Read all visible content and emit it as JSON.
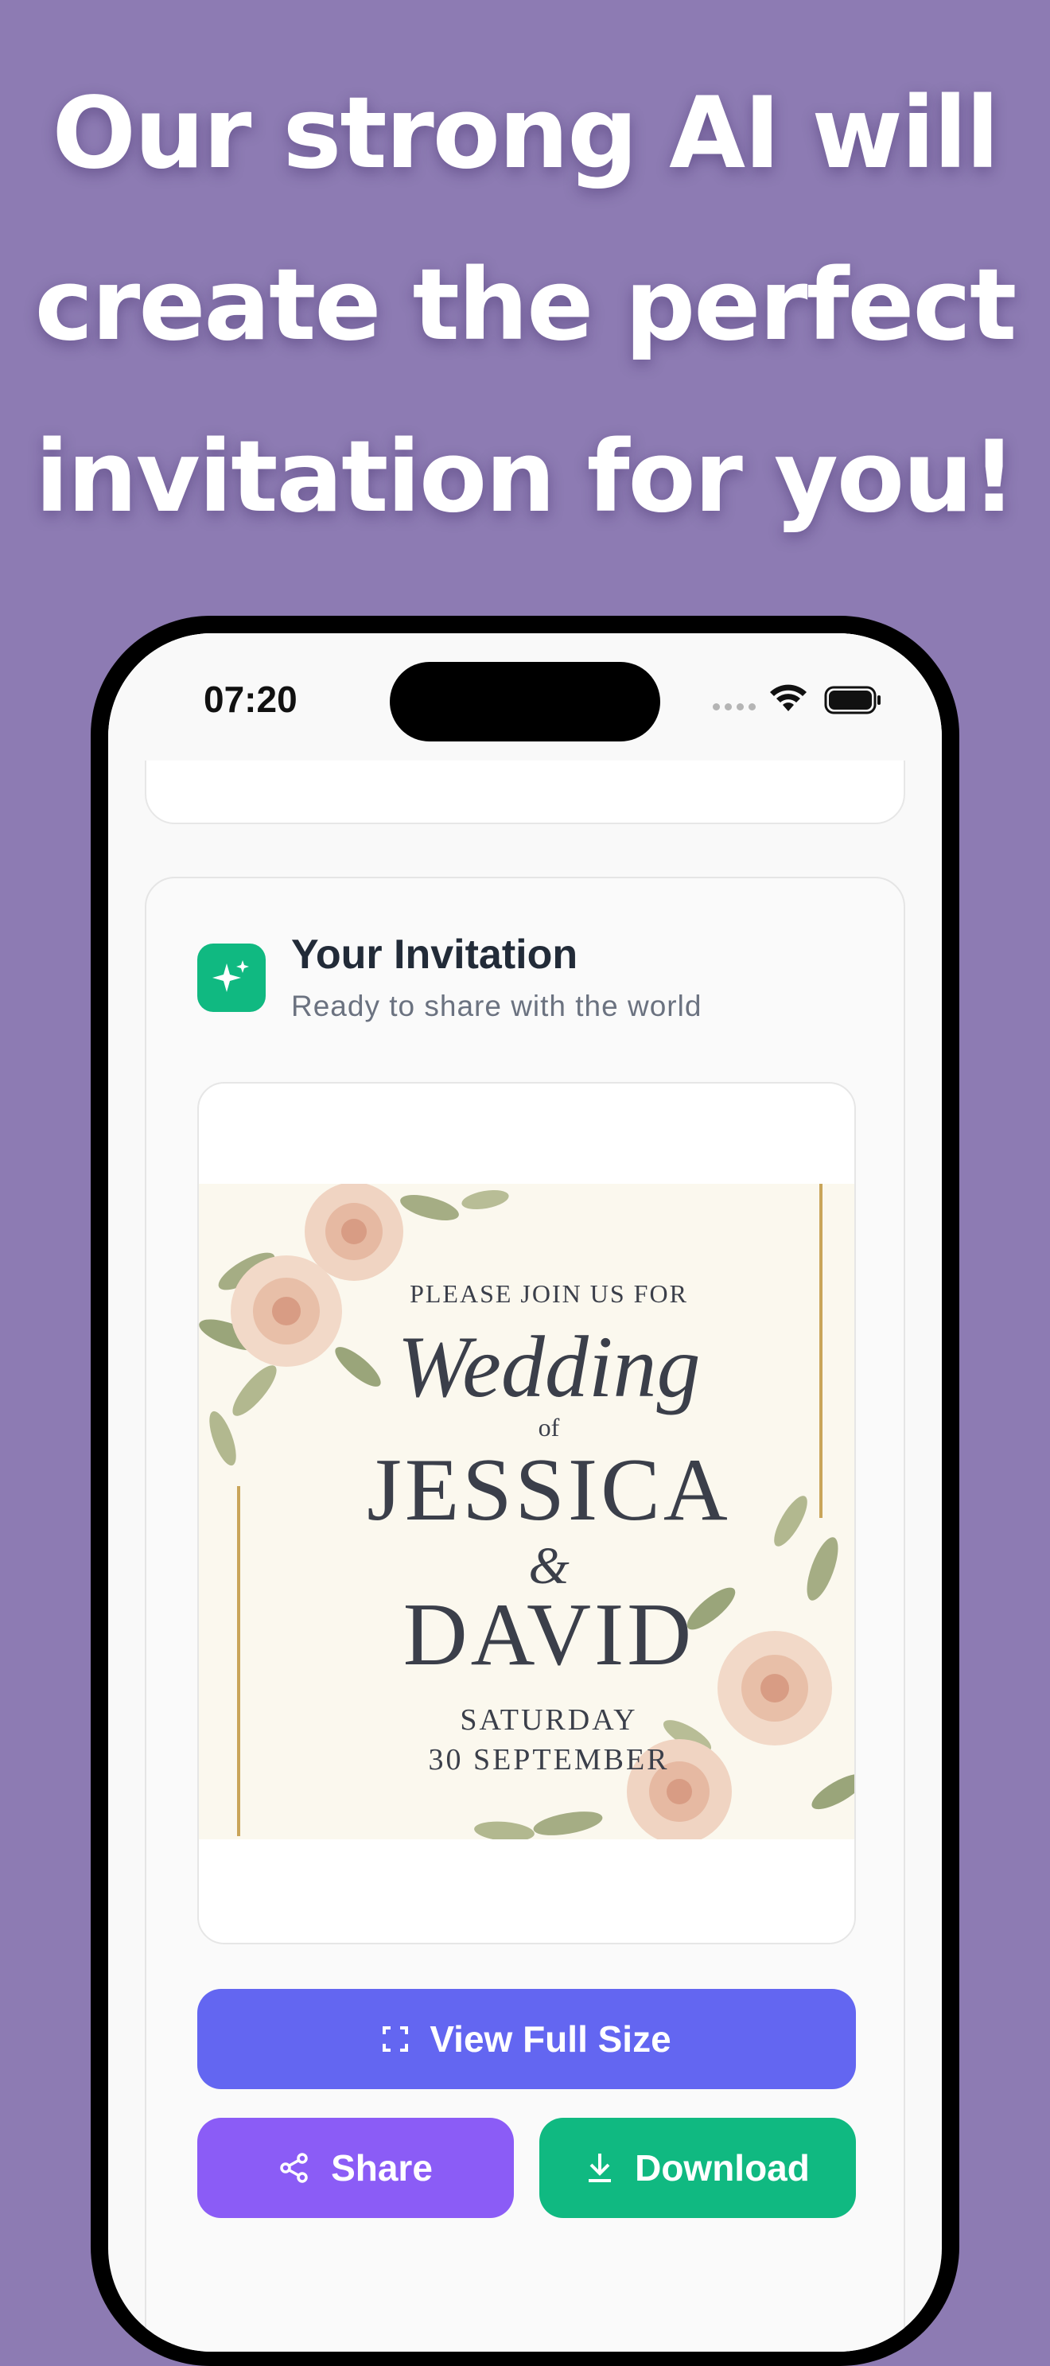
{
  "headline": {
    "line1": "Our strong AI will",
    "line2": "create the perfect",
    "line3": "invitation for you!"
  },
  "status_bar": {
    "time": "07:20"
  },
  "invitation_card": {
    "title": "Your Invitation",
    "subtitle": "Ready to share with the world",
    "icon": "sparkles-icon"
  },
  "invitation_image": {
    "join_text": "PLEASE JOIN US FOR",
    "script_text": "Wedding",
    "of_text": "of",
    "name1": "JESSICA",
    "ampersand": "&",
    "name2": "DAVID",
    "day": "SATURDAY",
    "date": "30 SEPTEMBER"
  },
  "actions": {
    "view_full_size": "View Full Size",
    "share": "Share",
    "download": "Download"
  },
  "colors": {
    "background": "#8d7bb3",
    "primary": "#6366f1",
    "share": "#8b5cf6",
    "download": "#10b981"
  }
}
